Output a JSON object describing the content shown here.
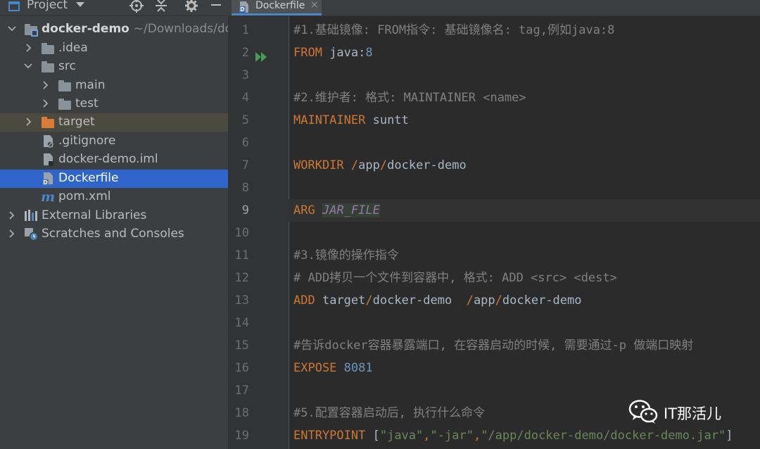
{
  "project_panel": {
    "title": "Project",
    "tree": [
      {
        "label": "docker-demo",
        "path": "~/Downloads/doc",
        "expanded": true,
        "icon": "module-folder-icon"
      },
      {
        "label": ".idea",
        "expanded": false,
        "icon": "folder-icon"
      },
      {
        "label": "src",
        "expanded": true,
        "icon": "folder-icon"
      },
      {
        "label": "main",
        "expanded": false,
        "icon": "folder-icon"
      },
      {
        "label": "test",
        "expanded": false,
        "icon": "folder-icon"
      },
      {
        "label": "target",
        "expanded": false,
        "icon": "folder-icon-excluded"
      },
      {
        "label": ".gitignore",
        "icon": "gitignore-file-icon"
      },
      {
        "label": "docker-demo.iml",
        "icon": "iml-file-icon"
      },
      {
        "label": "Dockerfile",
        "icon": "dockerfile-icon",
        "selected": true
      },
      {
        "label": "pom.xml",
        "icon": "maven-icon"
      },
      {
        "label": "External Libraries",
        "expanded": false,
        "icon": "library-icon"
      },
      {
        "label": "Scratches and Consoles",
        "expanded": false,
        "icon": "scratches-icon"
      }
    ]
  },
  "editor": {
    "tab_label": "Dockerfile",
    "current_line": 9,
    "line_numbers": [
      "1",
      "2",
      "3",
      "4",
      "5",
      "6",
      "7",
      "8",
      "9",
      "10",
      "11",
      "12",
      "13",
      "14",
      "15",
      "16",
      "17",
      "18",
      "19"
    ],
    "lines": [
      [
        {
          "t": "comment",
          "v": "#1.基础镜像: FROM指令: 基础镜像名: tag,例如java:8"
        }
      ],
      [
        {
          "t": "kw",
          "v": "FROM"
        },
        {
          "t": "plain",
          "v": " java:"
        },
        {
          "t": "num",
          "v": "8"
        }
      ],
      [],
      [
        {
          "t": "comment",
          "v": "#2.维护者: 格式: MAINTAINER <name>"
        }
      ],
      [
        {
          "t": "kw",
          "v": "MAINTAINER"
        },
        {
          "t": "plain",
          "v": " suntt"
        }
      ],
      [],
      [
        {
          "t": "kw",
          "v": "WORKDIR"
        },
        {
          "t": "plain",
          "v": " "
        },
        {
          "t": "kw",
          "v": "/"
        },
        {
          "t": "plain",
          "v": "app"
        },
        {
          "t": "kw",
          "v": "/"
        },
        {
          "t": "plain",
          "v": "docker-demo"
        }
      ],
      [],
      [
        {
          "t": "kw",
          "v": "ARG"
        },
        {
          "t": "plain",
          "v": " "
        },
        {
          "t": "var",
          "v": "JAR_FILE"
        }
      ],
      [],
      [
        {
          "t": "comment",
          "v": "#3.镜像的操作指令"
        }
      ],
      [
        {
          "t": "comment",
          "v": "# ADD拷贝一个文件到容器中, 格式: ADD <src> <dest>"
        }
      ],
      [
        {
          "t": "kw",
          "v": "ADD"
        },
        {
          "t": "plain",
          "v": " target"
        },
        {
          "t": "kw",
          "v": "/"
        },
        {
          "t": "plain",
          "v": "docker-demo  "
        },
        {
          "t": "kw",
          "v": "/"
        },
        {
          "t": "plain",
          "v": "app"
        },
        {
          "t": "kw",
          "v": "/"
        },
        {
          "t": "plain",
          "v": "docker-demo"
        }
      ],
      [],
      [
        {
          "t": "comment",
          "v": "#告诉docker容器暴露端口, 在容器启动的时候, 需要通过-p 做端口映射"
        }
      ],
      [
        {
          "t": "kw",
          "v": "EXPOSE"
        },
        {
          "t": "plain",
          "v": " "
        },
        {
          "t": "num",
          "v": "8081"
        }
      ],
      [],
      [
        {
          "t": "comment",
          "v": "#5.配置容器启动后, 执行什么命令"
        }
      ],
      [
        {
          "t": "kw",
          "v": "ENTRYPOINT"
        },
        {
          "t": "plain",
          "v": " ["
        },
        {
          "t": "str",
          "v": "\"java\""
        },
        {
          "t": "kw",
          "v": ","
        },
        {
          "t": "str",
          "v": "\"-jar\""
        },
        {
          "t": "kw",
          "v": ","
        },
        {
          "t": "str",
          "v": "\"/app/docker-demo/docker-demo.jar\""
        },
        {
          "t": "plain",
          "v": "]"
        }
      ]
    ]
  },
  "watermark": {
    "text": "IT那活儿",
    "icon": "wechat-icon"
  },
  "colors": {
    "keyword": "#cc7832",
    "comment": "#808080",
    "number": "#6897bb",
    "string": "#6a8759",
    "selection": "#2f65ca"
  }
}
